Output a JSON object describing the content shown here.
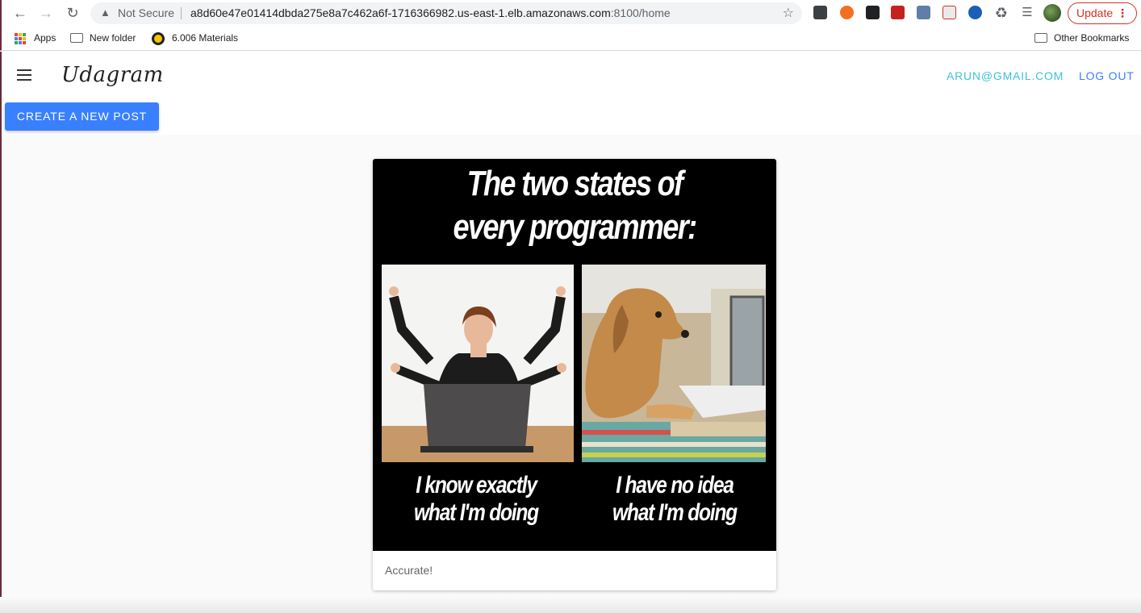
{
  "browser": {
    "security_label": "Not Secure",
    "url_host": "a8d60e47e01414dbda275e8a7c462a6f-1716366982.us-east-1.elb.amazonaws.com",
    "url_path": ":8100/home",
    "update_label": "Update",
    "bookmarks": {
      "apps_label": "Apps",
      "new_folder_label": "New folder",
      "materials_label": "6.006 Materials",
      "other_label": "Other Bookmarks"
    }
  },
  "app": {
    "brand": "Udagram",
    "user_email": "ARUN@GMAIL.COM",
    "logout_label": "LOG OUT",
    "create_post_label": "CREATE A NEW POST"
  },
  "feed": {
    "posts": [
      {
        "meme_title_line1": "The two states of",
        "meme_title_line2": "every programmer:",
        "left_caption_line1": "I know exactly",
        "left_caption_line2": "what I'm doing",
        "right_caption_line1": "I have no idea",
        "right_caption_line2": "what I'm doing",
        "caption": "Accurate!"
      }
    ]
  }
}
